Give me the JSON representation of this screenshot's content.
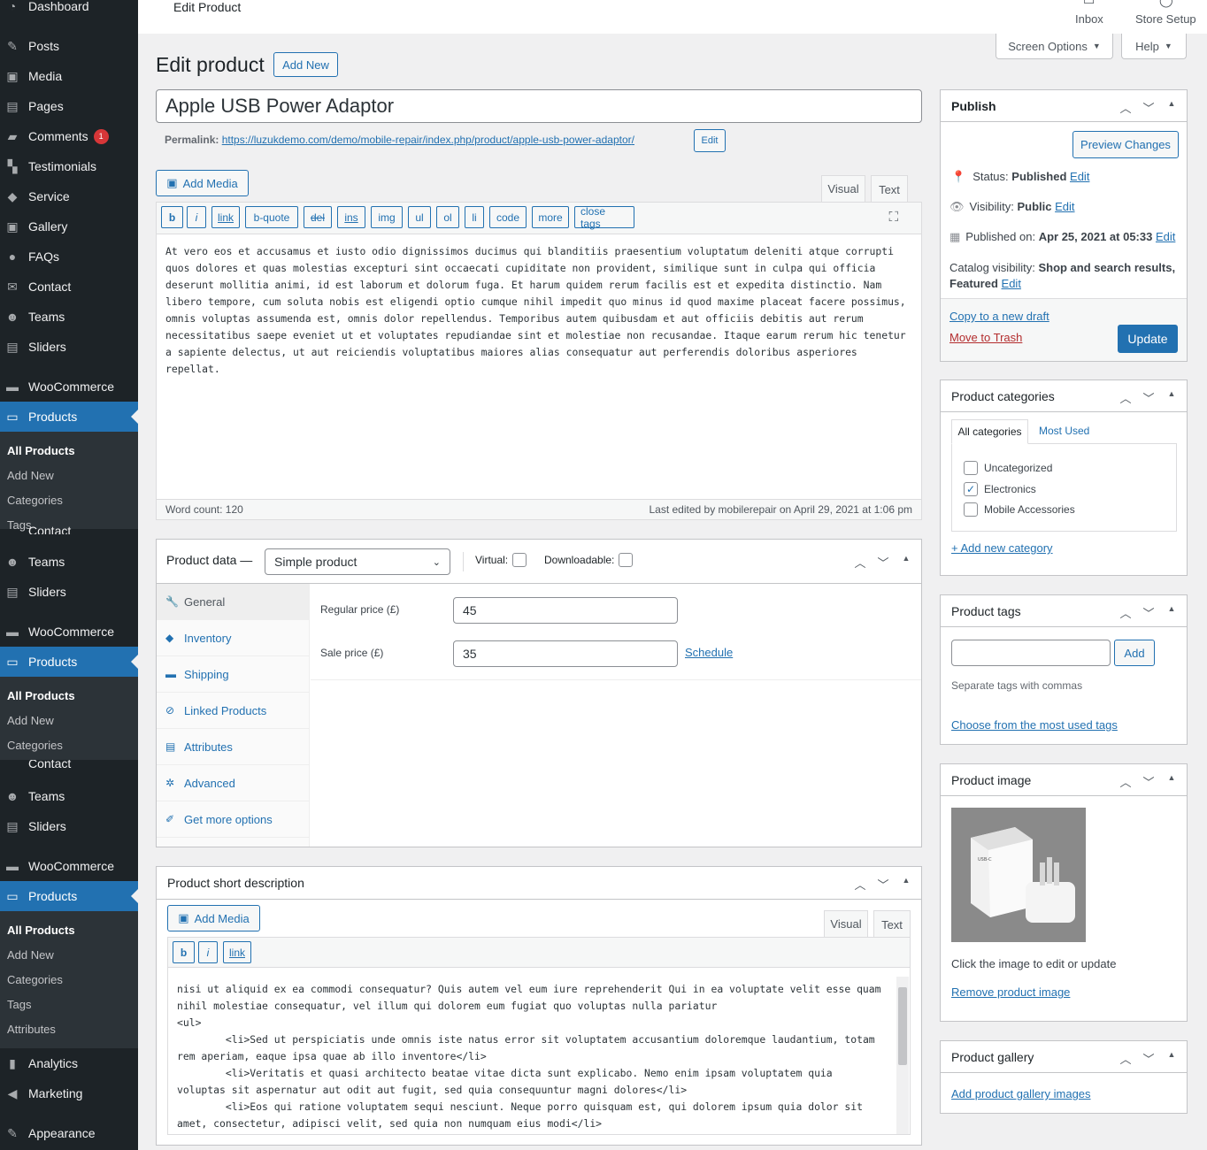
{
  "sidebar": {
    "top": [
      {
        "label": "Dashboard",
        "icon": "dashboard-icon"
      },
      {
        "label": "Posts",
        "icon": "pin-icon"
      },
      {
        "label": "Media",
        "icon": "media-icon"
      },
      {
        "label": "Pages",
        "icon": "pages-icon"
      },
      {
        "label": "Comments",
        "icon": "comment-icon",
        "badge": "1"
      },
      {
        "label": "Testimonials",
        "icon": "testimonial-icon"
      },
      {
        "label": "Service",
        "icon": "service-icon"
      },
      {
        "label": "Gallery",
        "icon": "gallery-icon"
      },
      {
        "label": "FAQs",
        "icon": "faq-icon"
      },
      {
        "label": "Contact",
        "icon": "mail-icon"
      },
      {
        "label": "Teams",
        "icon": "teams-icon"
      },
      {
        "label": "Sliders",
        "icon": "sliders-icon"
      },
      {
        "label": "WooCommerce",
        "icon": "woo-icon"
      },
      {
        "label": "Products",
        "icon": "archive-icon"
      }
    ],
    "sub1": [
      "All Products",
      "Add New",
      "Categories",
      "Tags"
    ],
    "ghost1": [
      "Contact",
      "Teams",
      "Sliders",
      "WooCommerce",
      "Products"
    ],
    "sub2": [
      "All Products",
      "Add New",
      "Categories"
    ],
    "ghost2": [
      "Contact",
      "Teams",
      "Sliders",
      "WooCommerce",
      "Products"
    ],
    "sub3": [
      "All Products",
      "Add New",
      "Categories",
      "Tags",
      "Attributes"
    ],
    "bottom": [
      "Analytics",
      "Marketing",
      "Appearance"
    ]
  },
  "topbar": {
    "title": "Edit Product",
    "inbox": "Inbox",
    "store_setup": "Store Setup",
    "screen_options": "Screen Options",
    "help": "Help"
  },
  "page": {
    "heading": "Edit product",
    "add_new": "Add New"
  },
  "product": {
    "title": "Apple USB Power Adaptor",
    "permalink_label": "Permalink:",
    "permalink_base": "https://luzukdemo.com/demo/mobile-repair/index.php/product/",
    "permalink_slug": "apple-usb-power-adaptor",
    "permalink_tail": "/",
    "edit": "Edit"
  },
  "editor": {
    "add_media": "Add Media",
    "tab_visual": "Visual",
    "tab_text": "Text",
    "quicktags": [
      "b",
      "i",
      "link",
      "b-quote",
      "del",
      "ins",
      "img",
      "ul",
      "ol",
      "li",
      "code",
      "more",
      "close tags"
    ],
    "content": "At vero eos et accusamus et iusto odio dignissimos ducimus qui blanditiis praesentium voluptatum deleniti atque corrupti quos dolores et quas molestias excepturi sint occaecati cupiditate non provident, similique sunt in culpa qui officia deserunt mollitia animi, id est laborum et dolorum fuga. Et harum quidem rerum facilis est et expedita distinctio. Nam libero tempore, cum soluta nobis est eligendi optio cumque nihil impedit quo minus id quod maxime placeat facere possimus, omnis voluptas assumenda est, omnis dolor repellendus. Temporibus autem quibusdam et aut officiis debitis aut rerum necessitatibus saepe eveniet ut et voluptates repudiandae sint et molestiae non recusandae. Itaque earum rerum hic tenetur a sapiente delectus, ut aut reiciendis voluptatibus maiores alias consequatur aut perferendis doloribus asperiores repellat.",
    "word_count": "Word count: 120",
    "last_edited": "Last edited by mobilerepair on April 29, 2021 at 1:06 pm"
  },
  "product_data": {
    "label": "Product data —",
    "type": "Simple product",
    "virtual": "Virtual:",
    "downloadable": "Downloadable:",
    "tabs": [
      "General",
      "Inventory",
      "Shipping",
      "Linked Products",
      "Attributes",
      "Advanced",
      "Get more options"
    ],
    "regular_price_label": "Regular price (£)",
    "regular_price": "45",
    "sale_price_label": "Sale price (£)",
    "sale_price": "35",
    "schedule": "Schedule"
  },
  "short_desc": {
    "title": "Product short description",
    "add_media": "Add Media",
    "tab_visual": "Visual",
    "tab_text": "Text",
    "quicktags": [
      "b",
      "i",
      "link"
    ],
    "content": "nisi ut aliquid ex ea commodi consequatur? Quis autem vel eum iure reprehenderit Qui in ea voluptate velit esse quam nihil molestiae consequatur, vel illum qui dolorem eum fugiat quo voluptas nulla pariatur\n<ul>\n        <li>Sed ut perspiciatis unde omnis iste natus error sit voluptatem accusantium doloremque laudantium, totam rem aperiam, eaque ipsa quae ab illo inventore</li>\n        <li>Veritatis et quasi architecto beatae vitae dicta sunt explicabo. Nemo enim ipsam voluptatem quia voluptas sit aspernatur aut odit aut fugit, sed quia consequuntur magni dolores</li>\n        <li>Eos qui ratione voluptatem sequi nesciunt. Neque porro quisquam est, qui dolorem ipsum quia dolor sit amet, consectetur, adipisci velit, sed quia non numquam eius modi</li>"
  },
  "publish": {
    "title": "Publish",
    "preview": "Preview Changes",
    "status_label": "Status:",
    "status": "Published",
    "visibility_label": "Visibility:",
    "visibility": "Public",
    "published_label": "Published on:",
    "published": "Apr 25, 2021 at 05:33",
    "catalog_label": "Catalog visibility:",
    "catalog_line1": "Shop and search results,",
    "catalog_line2": "Featured",
    "edit": "Edit",
    "copy": "Copy to a new draft",
    "trash": "Move to Trash",
    "update": "Update"
  },
  "categories": {
    "title": "Product categories",
    "tab_all": "All categories",
    "tab_most": "Most Used",
    "items": [
      {
        "label": "Uncategorized",
        "checked": false
      },
      {
        "label": "Electronics",
        "checked": true
      },
      {
        "label": "Mobile Accessories",
        "checked": false
      }
    ],
    "add": "+ Add new category"
  },
  "tags": {
    "title": "Product tags",
    "add": "Add",
    "help": "Separate tags with commas",
    "choose": "Choose from the most used tags"
  },
  "image": {
    "title": "Product image",
    "help": "Click the image to edit or update",
    "remove": "Remove product image",
    "box_text": "USB-C"
  },
  "gallery": {
    "title": "Product gallery",
    "add": "Add product gallery images"
  },
  "colors": {
    "accent": "#2271b1",
    "sidebar": "#1d2327",
    "danger": "#b32d2e"
  }
}
